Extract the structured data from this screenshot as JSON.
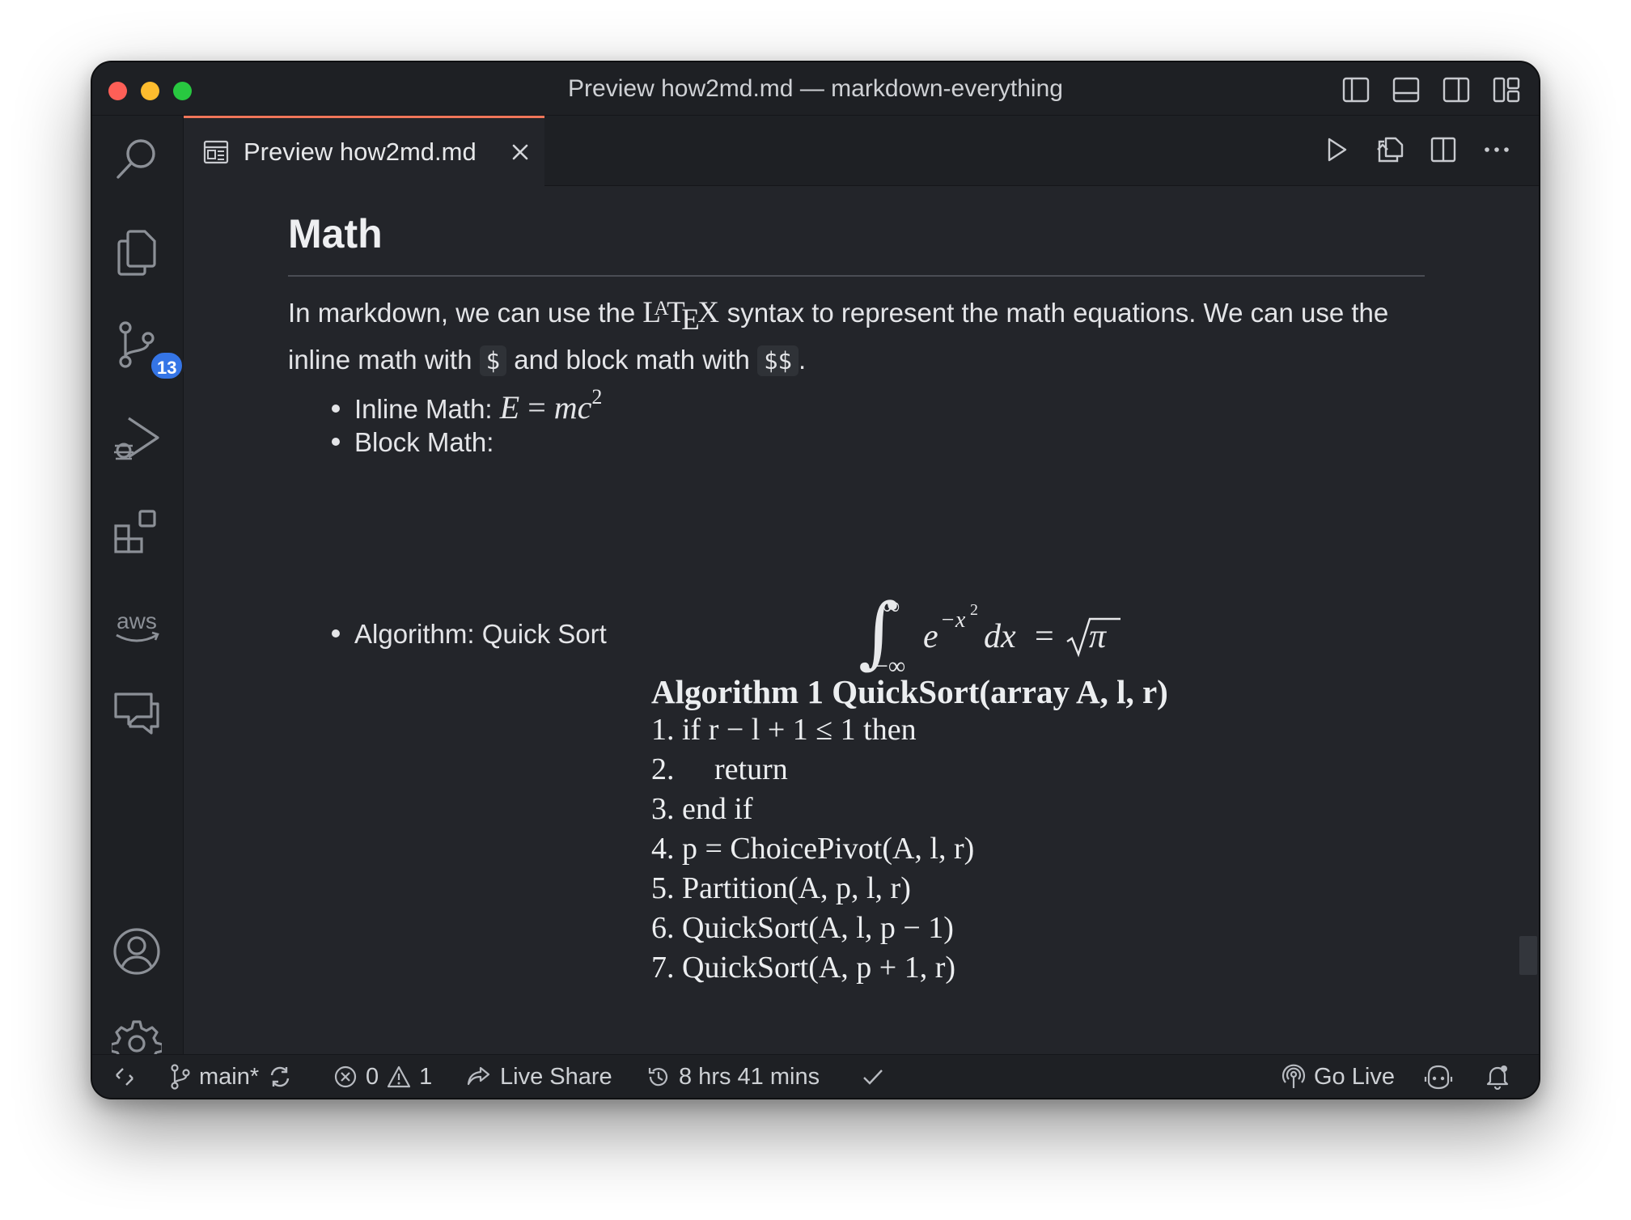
{
  "window": {
    "title": "Preview how2md.md — markdown-everything"
  },
  "tab": {
    "label": "Preview how2md.md"
  },
  "activity": {
    "source_control_badge": "13",
    "aws_label": "aws"
  },
  "doc": {
    "heading": "Math",
    "para_pre": "In markdown, we can use the ",
    "latex_L": "L",
    "latex_A": "A",
    "latex_T": "T",
    "latex_E": "E",
    "latex_X": "X",
    "para_mid": " syntax to represent the math equations. We can use the inline math with ",
    "code_inline": "$",
    "para_mid2": " and block math with ",
    "code_block": "$$",
    "para_end": ".",
    "bullets": [
      {
        "label": "Inline Math: "
      },
      {
        "label": "Block Math:"
      },
      {
        "label": "Algorithm: Quick Sort"
      }
    ]
  },
  "inline_math": {
    "E": "E",
    "eq": "=",
    "mc": "mc",
    "exp": "2"
  },
  "block_math": {
    "upper": "∞",
    "lower": "−∞",
    "e": "e",
    "exp": "−x",
    "exp2": "2",
    "dx": "dx",
    "eq": "=",
    "pi": "π"
  },
  "algorithm": {
    "title": "Algorithm 1 QuickSort(array A, l, r)",
    "lines": [
      {
        "num": "1.",
        "text": "if r − l + 1 ≤ 1 then"
      },
      {
        "num": "2.",
        "text": "return"
      },
      {
        "num": "3.",
        "text": "end if"
      },
      {
        "num": "4.",
        "text": "p = ChoicePivot(A, l, r)"
      },
      {
        "num": "5.",
        "text": "Partition(A, p, l, r)"
      },
      {
        "num": "6.",
        "text": "QuickSort(A, l, p − 1)"
      },
      {
        "num": "7.",
        "text": "QuickSort(A, p + 1, r)"
      }
    ]
  },
  "status": {
    "branch": "main*",
    "errors": "0",
    "warnings": "1",
    "live_share": "Live Share",
    "time": "8 hrs 41 mins",
    "go_live": "Go Live"
  },
  "colors": {
    "accent_tab": "#f0765a",
    "badge": "#3575e6",
    "background": "#23252a"
  }
}
